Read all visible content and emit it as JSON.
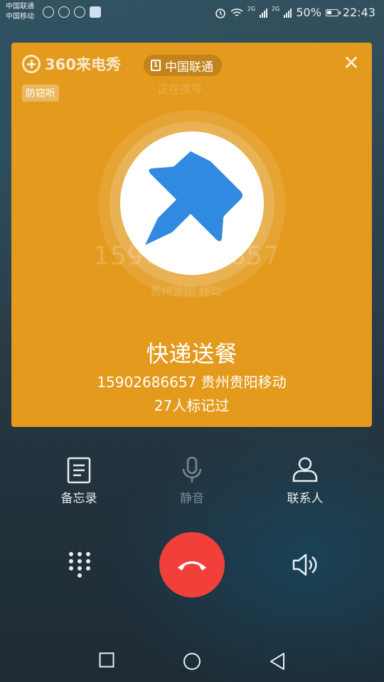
{
  "status_bar": {
    "carrier1": "中国联通",
    "carrier2": "中国移动",
    "sig1_label": "2G",
    "sig2_label": "2G",
    "battery": "50%",
    "time": "22:43"
  },
  "card": {
    "brand": "360来电秀",
    "carrier": "中国联通",
    "anti_eavesdrop_tag": "防窃听",
    "dialing_text": "正在拨号...",
    "ghost_number": "15902686657",
    "ghost_location": "贵州贵阳 移动",
    "mark_title": "快递送餐",
    "number_location": "15902686657 贵州贵阳移动",
    "mark_count": "27人标记过",
    "pin_color": "#2f8ae0",
    "card_color": "#e39a1d"
  },
  "controls": {
    "memo": "备忘录",
    "mute": "静音",
    "contacts": "联系人"
  },
  "colors": {
    "hangup": "#f1403a"
  }
}
